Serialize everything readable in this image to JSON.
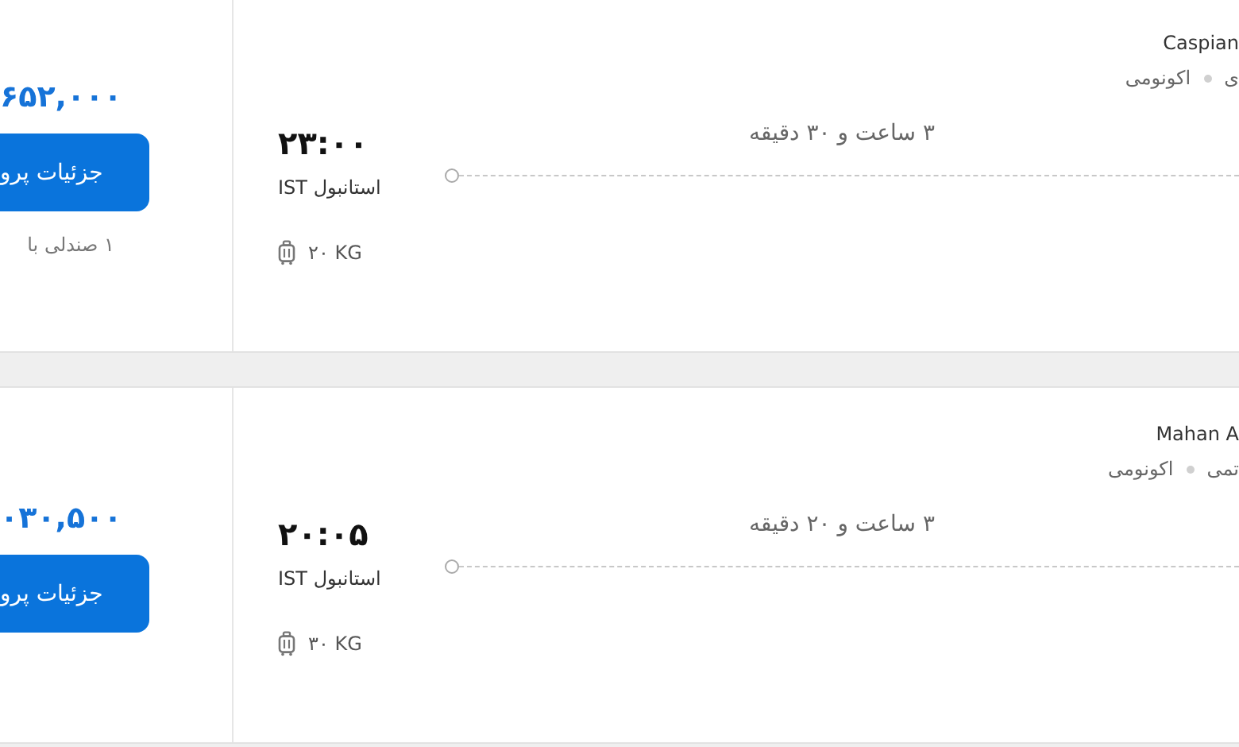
{
  "flights": [
    {
      "airline": "Caspian",
      "cabin_class": "اکونومی",
      "flight_type": "ی",
      "price": "۶۵۲,۰۰۰",
      "details_button": "جزئیات پرو",
      "seats_left": "۱ صندلی با",
      "departure_time": "۲۳:۰۰",
      "departure_airport": "استانبول IST",
      "duration": "۳ ساعت و ۳۰ دقیقه",
      "baggage": "۲۰ KG"
    },
    {
      "airline": "Mahan A",
      "cabin_class": "اکونومی",
      "flight_type": "تمی",
      "price": "۰۳۰,۵۰۰",
      "details_button": "جزئیات پرو",
      "departure_time": "۲۰:۰۵",
      "departure_airport": "استانبول IST",
      "duration": "۳ ساعت و ۲۰ دقیقه",
      "baggage": "۳۰ KG"
    }
  ]
}
